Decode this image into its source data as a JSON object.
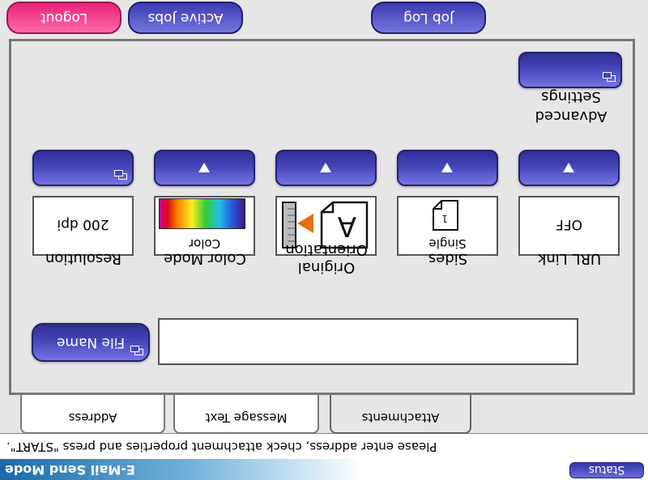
{
  "status_bar": {
    "mode_title": "E-Mail Send Mode",
    "status_button": "Status"
  },
  "instruction": "Please enter address, check attachment properties and press \"START\".",
  "tabs": [
    {
      "label": "Address"
    },
    {
      "label": "Message Text"
    },
    {
      "label": "Attachments",
      "active": true
    }
  ],
  "advanced_settings": {
    "label": "Advanced Settings"
  },
  "settings": {
    "resolution": {
      "label": "Resolution",
      "value": "200 dpi"
    },
    "color_mode": {
      "label": "Color Mode",
      "value": "Color"
    },
    "orientation": {
      "label": "Original Orientation"
    },
    "sides": {
      "label": "Sides",
      "value": "Single"
    },
    "url_link": {
      "label": "URL Link",
      "value": "OFF"
    }
  },
  "file_name": {
    "button_label": "File Name",
    "value": ""
  },
  "top_buttons": {
    "logout": "Logout",
    "active_jobs": "Active Jobs",
    "job_log": "Job Log"
  },
  "colors": {
    "button_blue": "#4545b8",
    "logout_pink": "#e8247a",
    "panel_gray": "#e6e6e6"
  }
}
